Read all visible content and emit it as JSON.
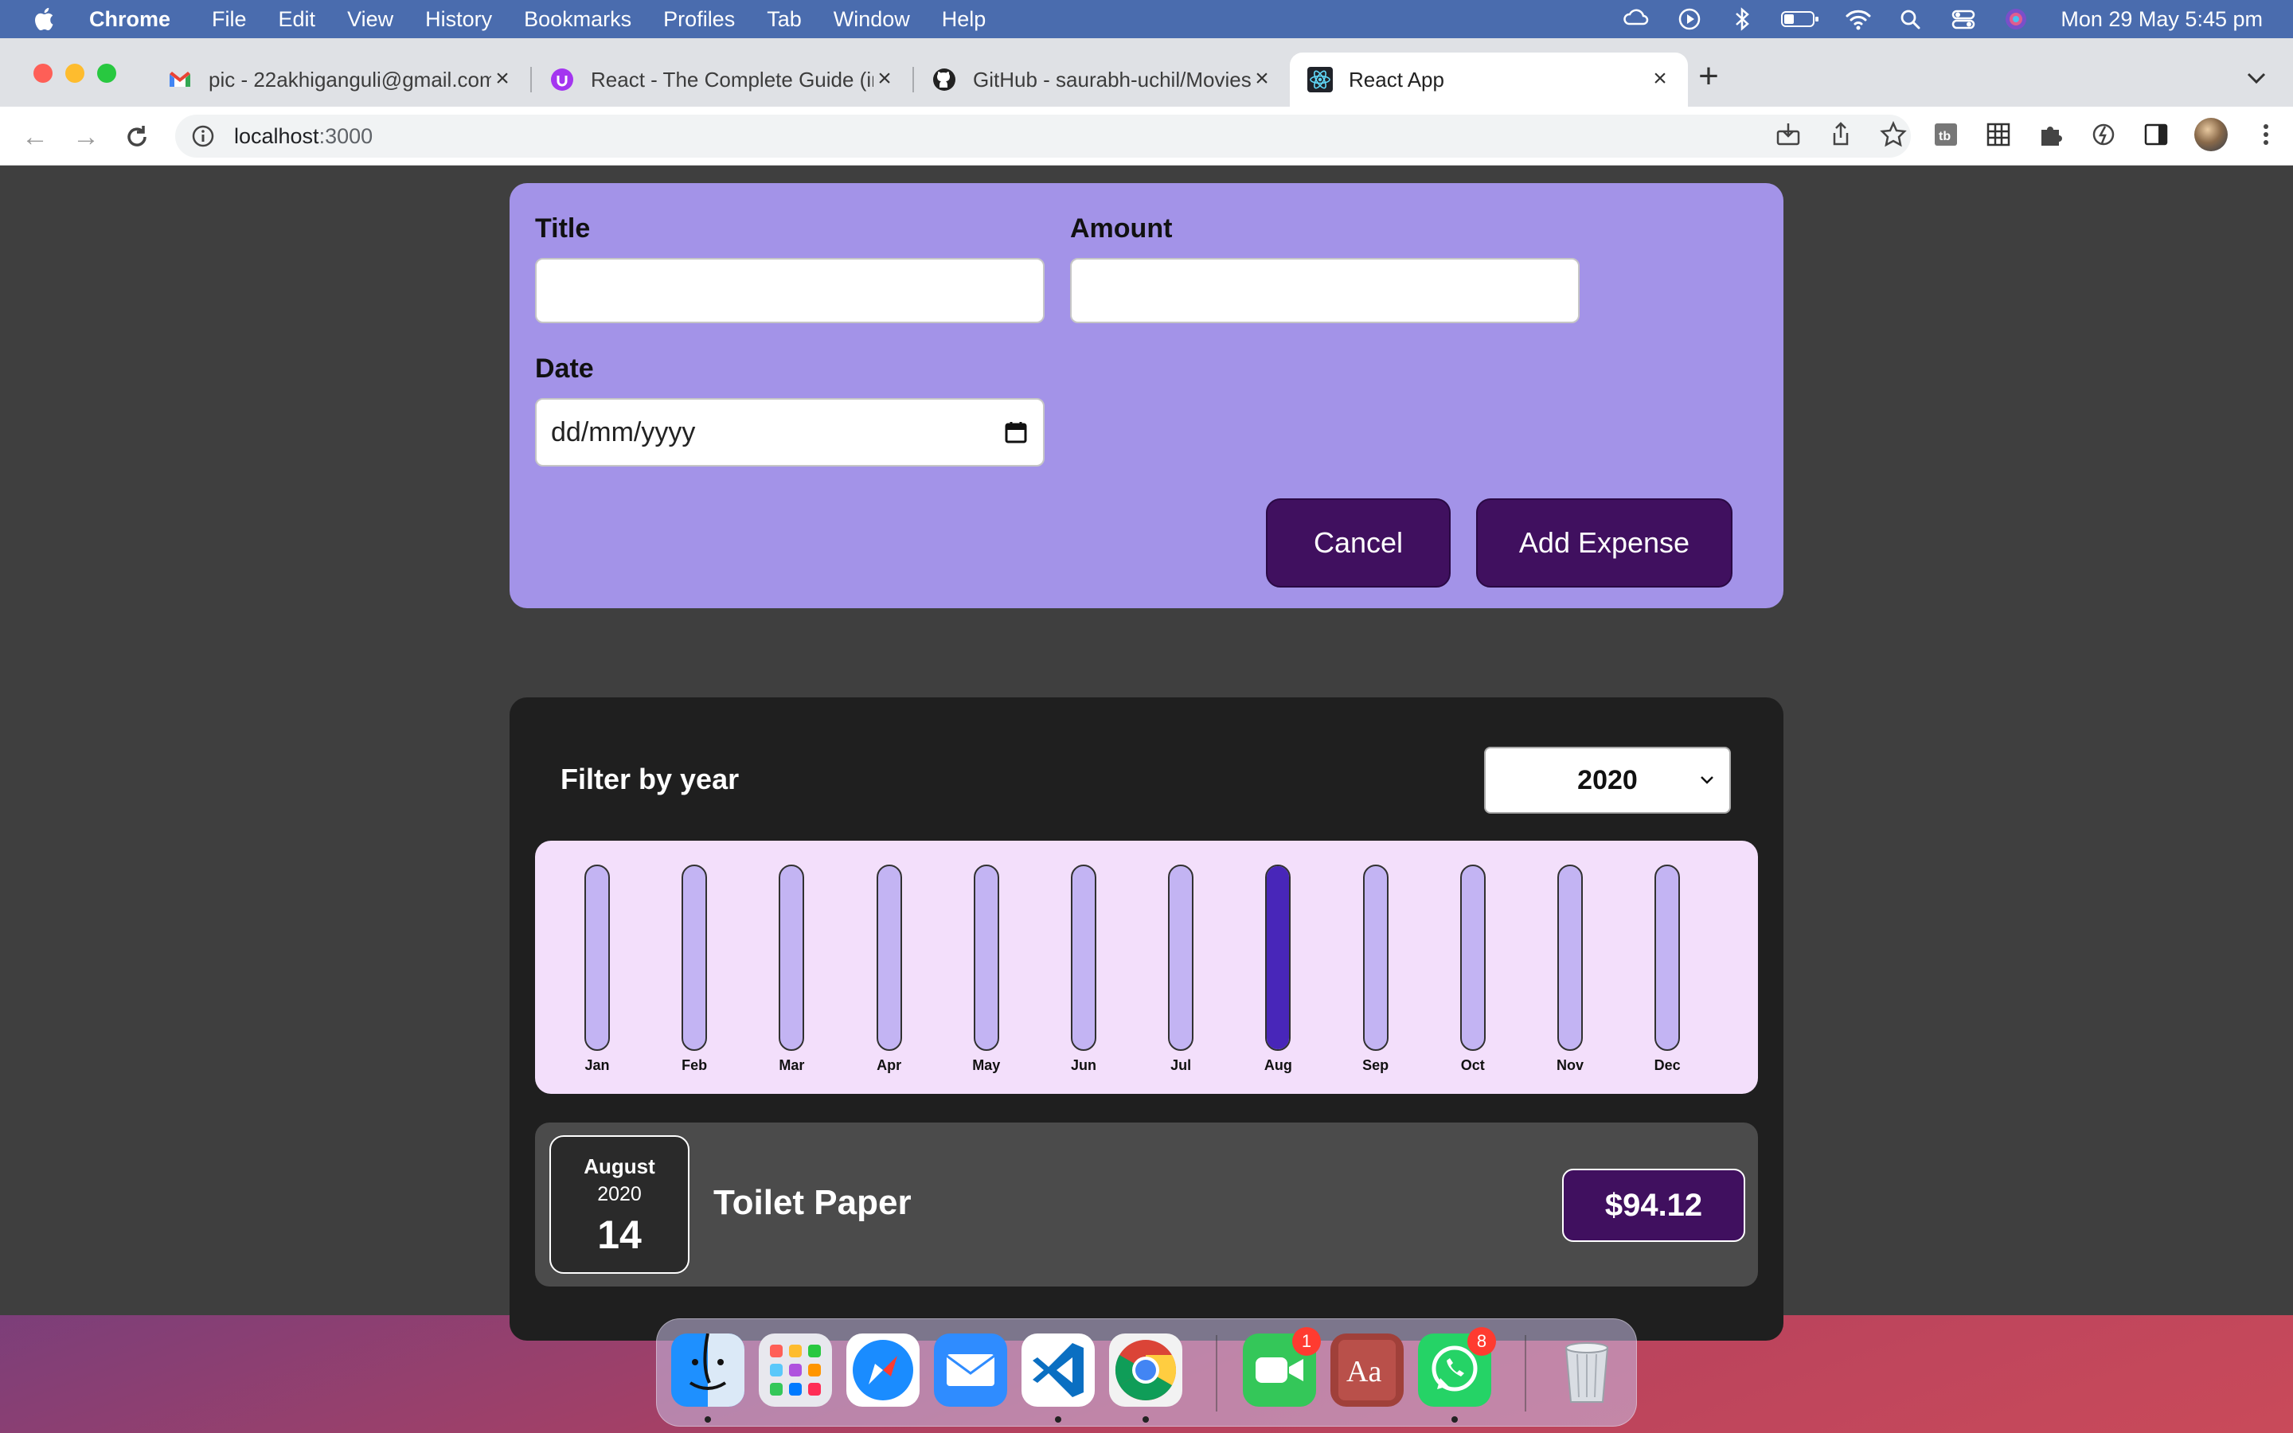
{
  "menubar": {
    "app": "Chrome",
    "items": [
      "File",
      "Edit",
      "View",
      "History",
      "Bookmarks",
      "Profiles",
      "Tab",
      "Window",
      "Help"
    ],
    "clock": "Mon 29 May  5:45 pm",
    "status_icons": [
      "creative-cloud-icon",
      "play-icon",
      "bluetooth-icon",
      "battery-icon",
      "wifi-icon",
      "search-icon",
      "control-center-icon",
      "siri-icon"
    ]
  },
  "tabs": [
    {
      "label": "pic - 22akhiganguli@gmail.com",
      "icon": "gmail-icon"
    },
    {
      "label": "React - The Complete Guide (incl",
      "icon": "udemy-icon"
    },
    {
      "label": "GitHub - saurabh-uchil/Movies",
      "icon": "github-icon"
    },
    {
      "label": "React App",
      "icon": "react-icon",
      "active": true
    }
  ],
  "address": {
    "host": "localhost",
    "port": ":3000"
  },
  "form": {
    "title_label": "Title",
    "title_value": "",
    "amount_label": "Amount",
    "amount_value": "",
    "date_label": "Date",
    "date_placeholder": "dd/mm/yyyy",
    "cancel_label": "Cancel",
    "submit_label": "Add Expense"
  },
  "filter": {
    "label": "Filter by year",
    "selected_year": "2020"
  },
  "chart_data": {
    "type": "bar",
    "categories": [
      "Jan",
      "Feb",
      "Mar",
      "Apr",
      "May",
      "Jun",
      "Jul",
      "Aug",
      "Sep",
      "Oct",
      "Nov",
      "Dec"
    ],
    "values": [
      0,
      0,
      0,
      0,
      0,
      0,
      0,
      94.12,
      0,
      0,
      0,
      0
    ],
    "fill_colors": {
      "empty": "#c3b4f3",
      "filled": "#4826b9"
    }
  },
  "expenses": [
    {
      "month": "August",
      "year": "2020",
      "day": "14",
      "title": "Toilet Paper",
      "amount": "$94.12"
    }
  ],
  "dock": {
    "apps": [
      "finder-icon",
      "launchpad-icon",
      "safari-icon",
      "mail-icon",
      "vscode-icon",
      "chrome-icon",
      "facetime-icon",
      "dictionary-icon",
      "whatsapp-icon",
      "trash-icon"
    ],
    "badges": {
      "facetime": "1",
      "whatsapp": "8"
    }
  },
  "colors": {
    "form_bg": "#a393e8",
    "button_bg": "#40105f",
    "chart_bg": "#f3dffb",
    "panel_bg": "#1f1f1f"
  }
}
